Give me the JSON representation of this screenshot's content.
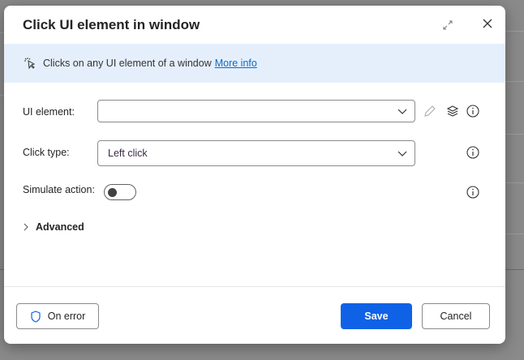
{
  "dialog": {
    "title": "Click UI element in window",
    "banner": {
      "text": "Clicks on any UI element of a window",
      "link": "More info"
    },
    "fields": {
      "ui_element": {
        "label": "UI element:",
        "value": ""
      },
      "click_type": {
        "label": "Click type:",
        "value": "Left click"
      },
      "simulate_action": {
        "label": "Simulate action:",
        "on": false
      }
    },
    "advanced_label": "Advanced",
    "footer": {
      "on_error": "On error",
      "save": "Save",
      "cancel": "Cancel"
    }
  },
  "colors": {
    "accent": "#0f62e6",
    "banner": "#e5effc",
    "link": "#0f6cbd"
  }
}
